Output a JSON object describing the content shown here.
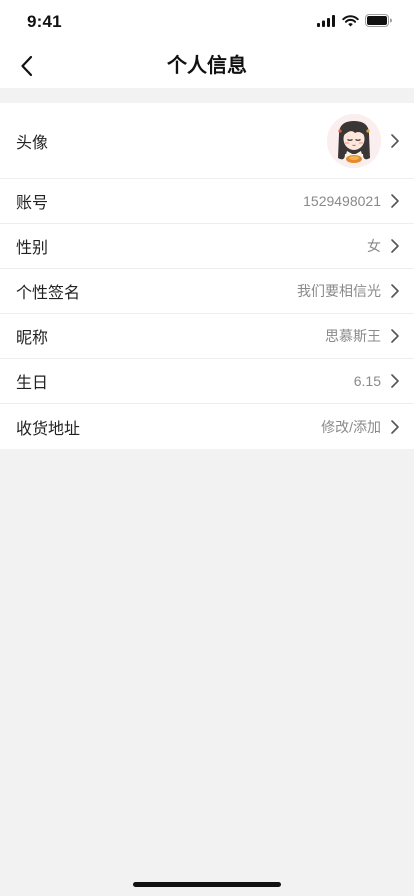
{
  "status_bar": {
    "time": "9:41"
  },
  "nav": {
    "title": "个人信息",
    "back_icon": "chevron-left-icon"
  },
  "profile": {
    "rows": [
      {
        "label": "头像",
        "kind": "avatar",
        "value": ""
      },
      {
        "label": "账号",
        "value": "1529498021"
      },
      {
        "label": "性别",
        "value": "女"
      },
      {
        "label": "个性签名",
        "value": "我们要相信光"
      },
      {
        "label": "昵称",
        "value": "思慕斯王"
      },
      {
        "label": "生日",
        "value": "6.15"
      },
      {
        "label": "收货地址",
        "value": "修改/添加"
      }
    ]
  },
  "colors": {
    "background": "#f2f2f2",
    "card": "#ffffff",
    "label_text": "#222222",
    "value_text": "#8a8a8a",
    "divider": "#eeeeee",
    "chevron": "#555555"
  }
}
